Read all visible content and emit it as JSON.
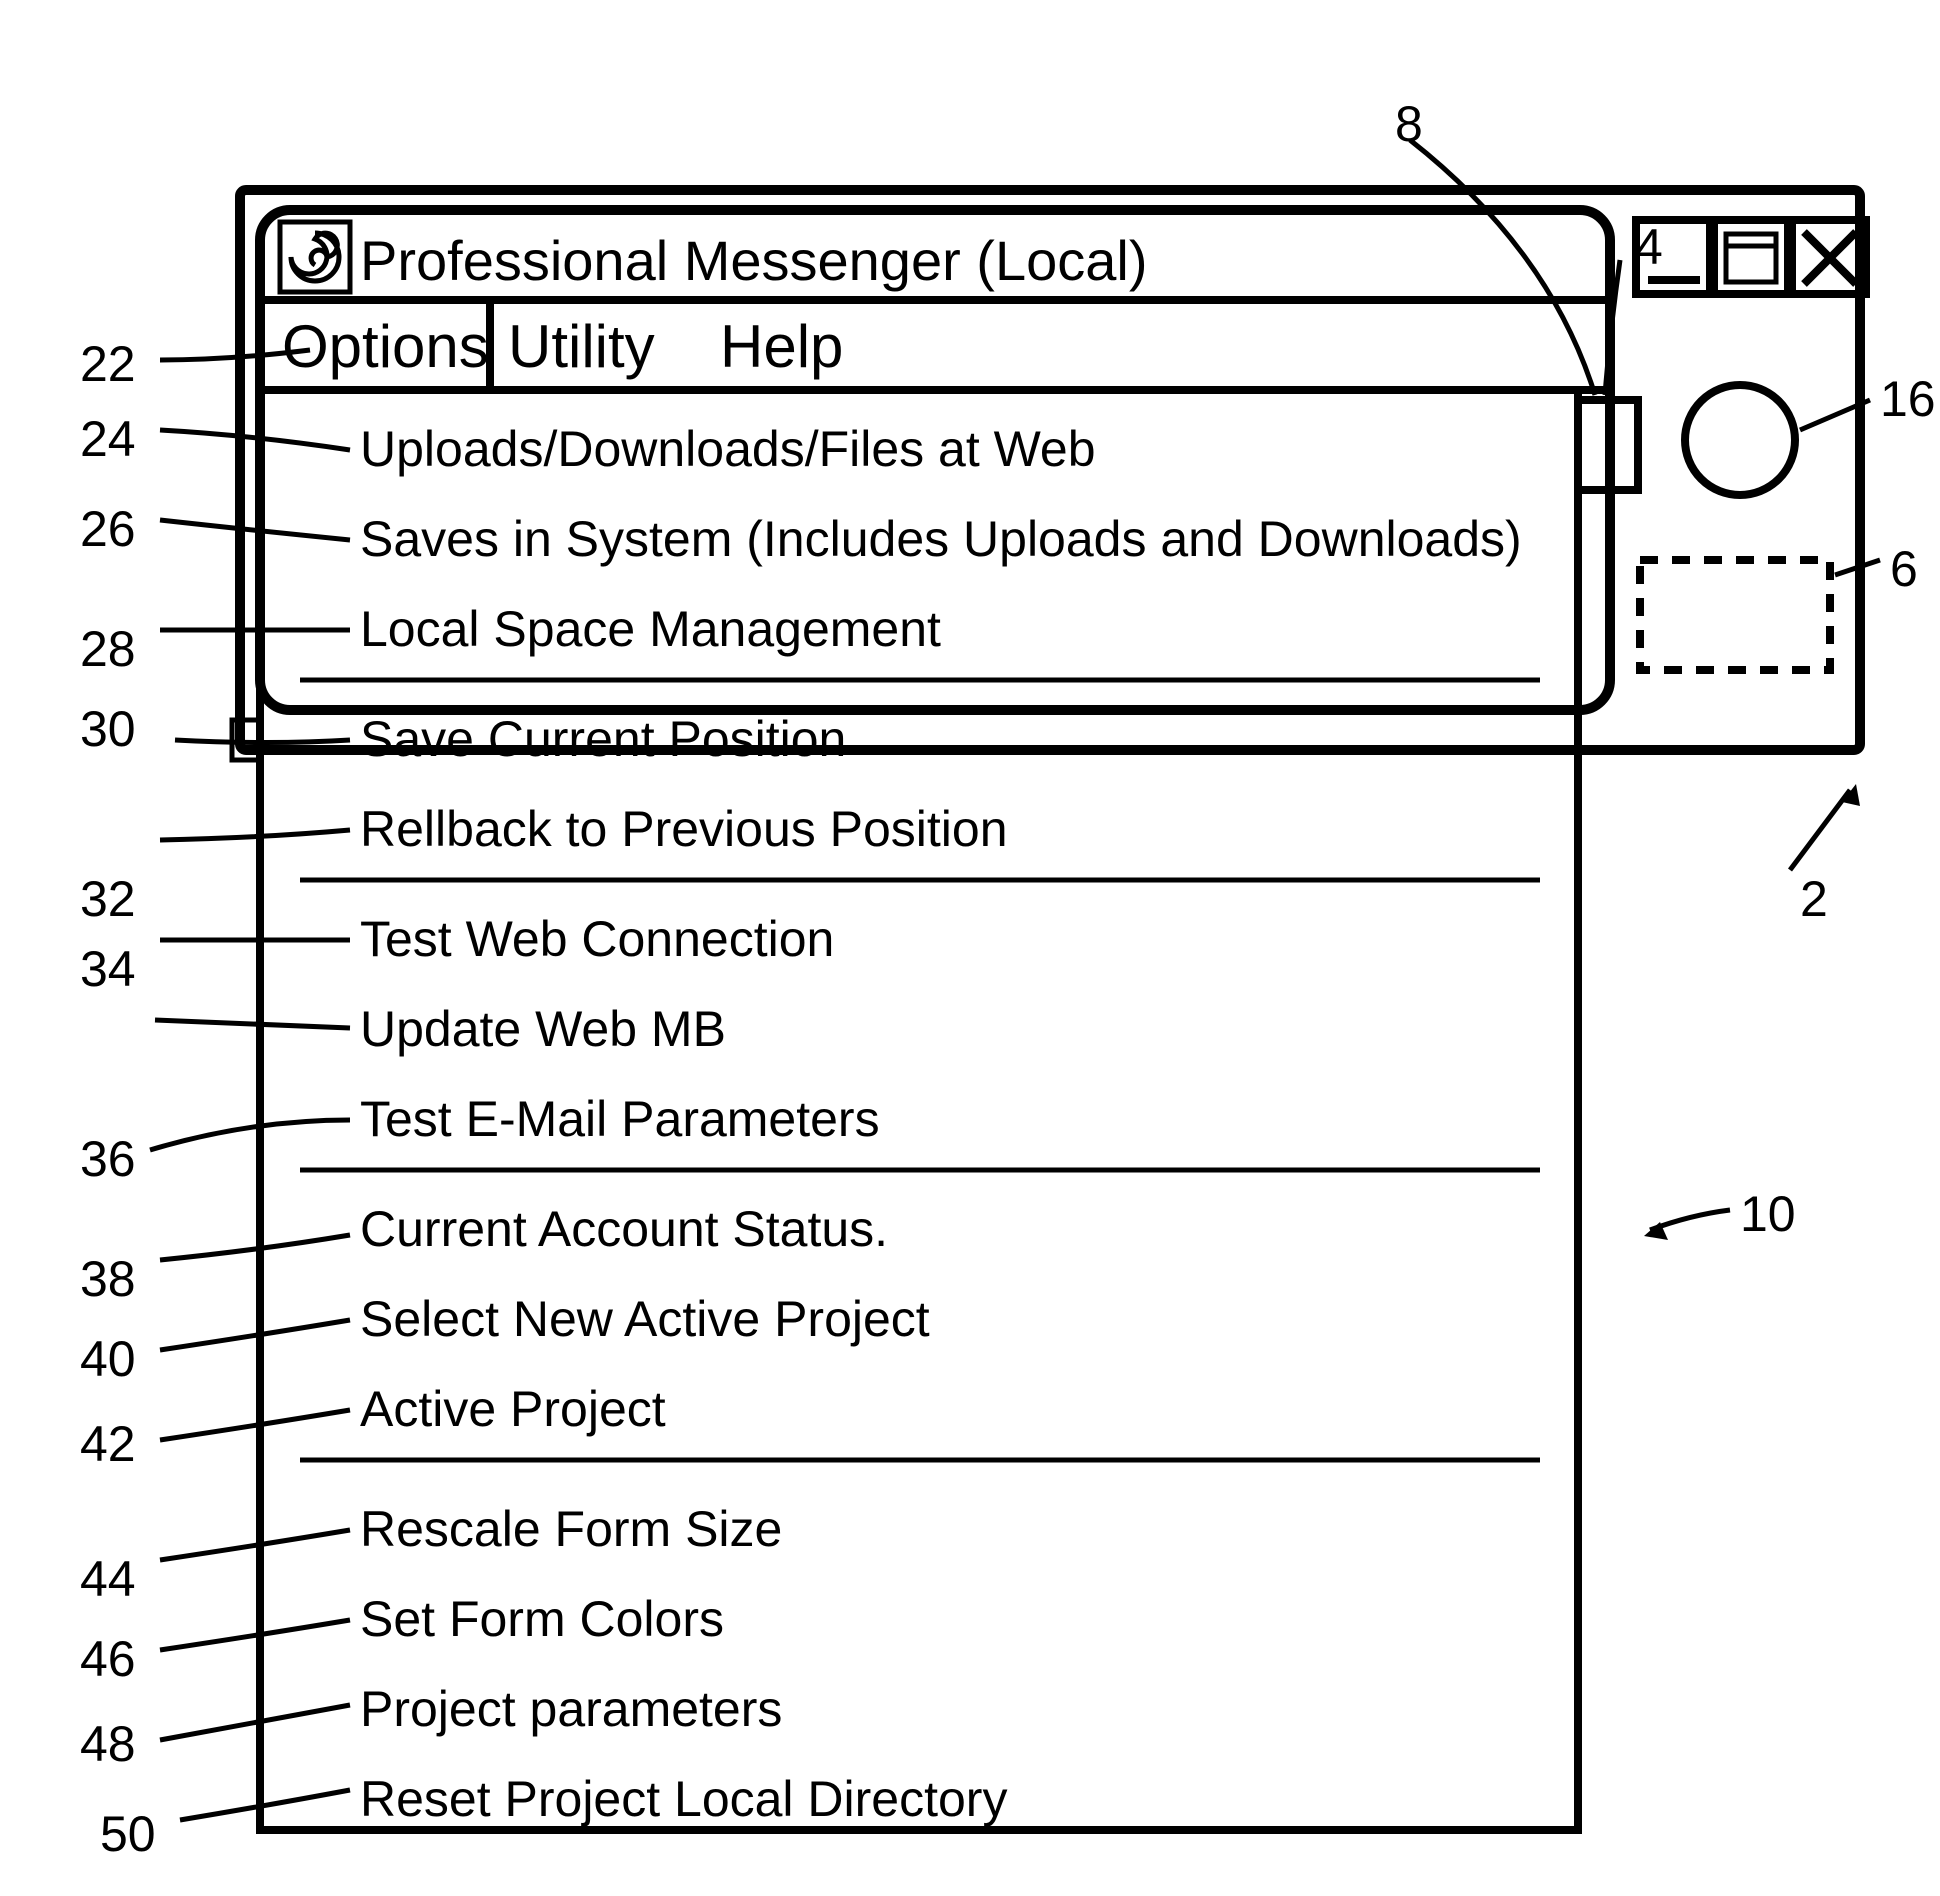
{
  "window": {
    "title": "Professional Messenger (Local)"
  },
  "menubar": {
    "options": "Options",
    "utility": "Utility",
    "help": "Help"
  },
  "menu_items": [
    "Uploads/Downloads/Files at Web",
    "Saves in System (Includes Uploads and Downloads)",
    "Local Space Management",
    "Save Current Position",
    "Rellback to Previous Position",
    "Test Web Connection",
    "Update Web MB",
    "Test E-Mail Parameters",
    "Current Account Status.",
    "Select New Active Project",
    "Active Project",
    "Rescale Form Size",
    "Set Form Colors",
    "Project parameters",
    "Reset Project Local Directory"
  ],
  "callouts": {
    "c2": "2",
    "c4": "4",
    "c6": "6",
    "c8": "8",
    "c10": "10",
    "c16": "16",
    "c22": "22",
    "c24": "24",
    "c26": "26",
    "c28": "28",
    "c30": "30",
    "c32": "32",
    "c34": "34",
    "c36": "36",
    "c38": "38",
    "c40": "40",
    "c42": "42",
    "c44": "44",
    "c46": "46",
    "c48": "48",
    "c50": "50"
  }
}
